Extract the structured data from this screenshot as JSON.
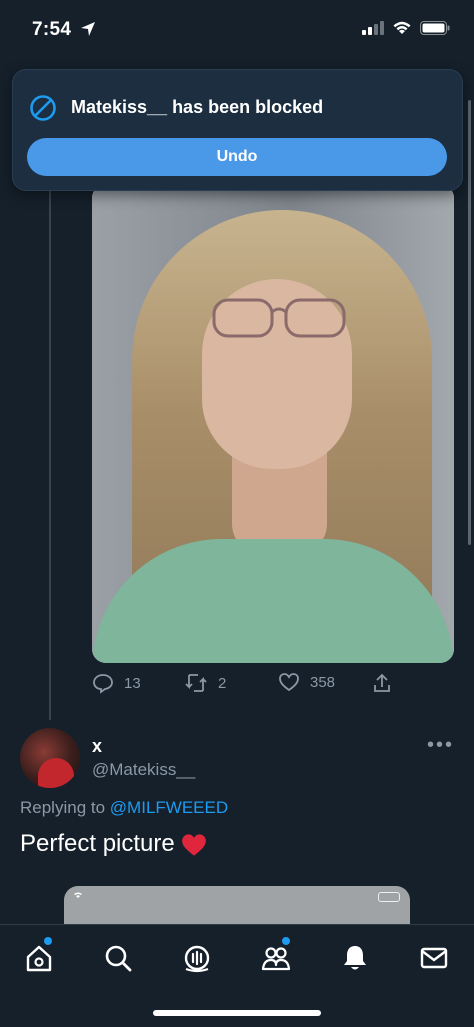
{
  "status_bar": {
    "time": "7:54"
  },
  "toast": {
    "message": "Matekiss__ has been blocked",
    "undo_label": "Undo"
  },
  "tweet_actions": {
    "replies": "13",
    "retweets": "2",
    "likes": "358"
  },
  "reply": {
    "name": "x",
    "handle": "@Matekiss__",
    "replying_prefix": "Replying to",
    "replying_to": "@MILFWEEED",
    "text": "Perfect picture"
  },
  "tabs": [
    "home",
    "search",
    "spaces",
    "communities",
    "notifications",
    "messages"
  ],
  "colors": {
    "accent": "#1d9bf0",
    "background": "#15202b",
    "undo_button": "#4a99e9"
  }
}
